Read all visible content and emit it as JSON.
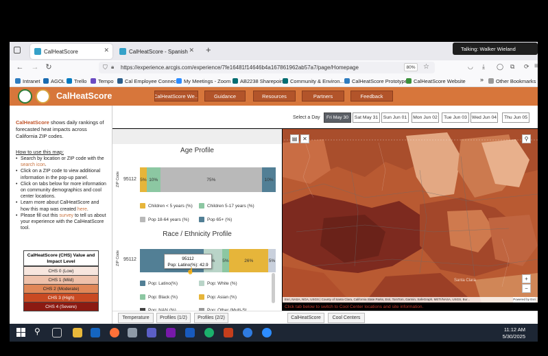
{
  "browser": {
    "tabs": [
      {
        "label": "CalHeatScore",
        "active": true
      },
      {
        "label": "CalHeatScore - Spanish",
        "active": false
      }
    ],
    "new_tab": "+",
    "url": "https://experience.arcgis.com/experience/7fe16481f14646b4a167861962ab57a7/page/Homepage",
    "zoom": "80%",
    "bookmarks": [
      "Intranet",
      "AGOL",
      "Trello",
      "Tempo",
      "Cal Employee Connect",
      "My Meetings - Zoom",
      "AB2238 Sharepoint",
      "Community & Environ...",
      "CalHeatScore Prototype",
      "CalHeatScore Website"
    ],
    "other_bookmarks": "Other Bookmarks",
    "talking": "Talking: Walker Wieland"
  },
  "app": {
    "title": "CalHeatScore",
    "nav": [
      "CalHeatScore We...",
      "Guidance",
      "Resources",
      "Partners",
      "Feedback"
    ],
    "select_day_label": "Select a Day",
    "days": [
      {
        "label": "Fri May 30",
        "active": true
      },
      {
        "label": "Sat May 31",
        "active": false
      },
      {
        "label": "Sun Jun 01",
        "active": false
      },
      {
        "label": "Mon Jun 02",
        "active": false
      },
      {
        "label": "Tue Jun 03",
        "active": false
      },
      {
        "label": "Wed Jun 04",
        "active": false
      },
      {
        "label": "Thu Jun 05",
        "active": false
      }
    ]
  },
  "left": {
    "brand": "CalHeatScore",
    "intro_rest": " shows daily rankings of forecasted heat impacts across California ZIP codes.",
    "howto_title": "How to use this map:",
    "steps": [
      [
        "Search by location or ZIP code with the ",
        "search icon",
        "."
      ],
      [
        "Click on a ZIP code to view additional information in the pop-up panel.",
        "",
        ""
      ],
      [
        "Click on tabs below for more information on community demographics and cool center locations.",
        "",
        ""
      ],
      [
        "Learn more about CalHeatScore and how this map was created ",
        "here",
        "."
      ],
      [
        "Please fill out this ",
        "survey",
        " to tell us about your experience with the CalHeatScore tool."
      ]
    ],
    "legend_title": "CalHeatScore (CHS) Value and Impact Level",
    "legend": [
      {
        "label": "CHS 0 (Low)",
        "color": "#f7e6de",
        "text": "#222"
      },
      {
        "label": "CHS 1 (Mild)",
        "color": "#eec1aa",
        "text": "#222"
      },
      {
        "label": "CHS 2 (Moderate)",
        "color": "#e08757",
        "text": "#222"
      },
      {
        "label": "CHS 3 (High)",
        "color": "#c94a22",
        "text": "#fff"
      },
      {
        "label": "CHS 4 (Severe)",
        "color": "#8b1a12",
        "text": "#fff"
      }
    ]
  },
  "age_profile": {
    "title": "Age Profile",
    "ylabel": "ZIP Code",
    "zip": "95112",
    "segments": [
      {
        "name": "Children < 5 years (%)",
        "value": 5,
        "label": "5%",
        "color": "#e6b53a"
      },
      {
        "name": "Children 5-17 years (%)",
        "value": 10,
        "label": "10%",
        "color": "#8cc7a2"
      },
      {
        "name": "Pop 18-64 years (%)",
        "value": 75,
        "label": "75%",
        "color": "#b9b9b9"
      },
      {
        "name": "Pop 65+ (%)",
        "value": 10,
        "label": "10%",
        "color": "#527f95"
      }
    ]
  },
  "race_profile": {
    "title": "Race / Ethnicity Profile",
    "ylabel": "ZIP Code",
    "zip": "95112",
    "segments": [
      {
        "name": "Pop: Latino(%)",
        "value": 42.9,
        "label": "",
        "color": "#527f95"
      },
      {
        "name": "Pop: White (%)",
        "value": 12,
        "label": "%",
        "color": "#b9d4c8"
      },
      {
        "name": "Pop: Black (%)",
        "value": 5,
        "label": "5%",
        "color": "#8cc7a2"
      },
      {
        "name": "Pop: Asian (%)",
        "value": 26,
        "label": "26%",
        "color": "#e6b53a"
      },
      {
        "name": "Pop: Other",
        "value": 5,
        "label": "5%",
        "color": "#c9d0dc"
      }
    ],
    "legend_extra": [
      "Pop: NAN (%)",
      "Pop: Other (Multi-St..."
    ],
    "tooltip_zip": "95112",
    "tooltip_value": "Pop: Latino(%): 42.9"
  },
  "bottom_tabs_left": [
    "Temperature",
    "Profiles (1/2)",
    "Profiles (2/2)"
  ],
  "bottom_tabs_right": [
    "CalHeatScore",
    "Cool Centers"
  ],
  "map": {
    "attribution": "Esri, NASA, NGA, USGS | County of Santa Clara, California State Parks, Esri, TomTom, Garmin, SafeGraph, METI/NASA, USGS, Bur...",
    "powered": "Powered by Esri",
    "hint": "Click tab below to switch to Cool Center locations and site information.",
    "place": "Santa Clara"
  },
  "taskbar": {
    "time": "11:12 AM",
    "date": "5/30/2025"
  }
}
